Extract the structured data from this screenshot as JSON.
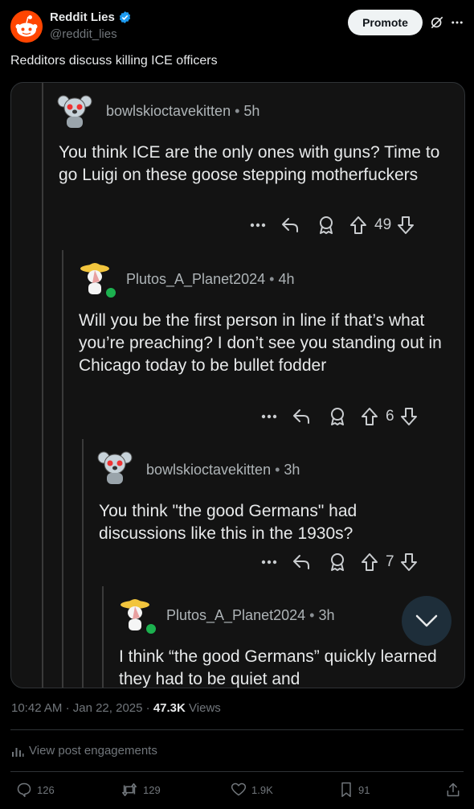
{
  "account": {
    "display_name": "Reddit Lies",
    "handle": "@reddit_lies",
    "verified": true,
    "avatar_icon": "reddit-snoo-icon"
  },
  "header": {
    "promote_label": "Promote"
  },
  "tweet": {
    "text": "Redditors discuss killing ICE officers"
  },
  "comments": [
    {
      "user": "bowlskioctavekitten",
      "age": "5h",
      "body": "You think ICE are the only ones with guns? Time to go Luigi on these goose stepping motherfuckers",
      "votes": "49"
    },
    {
      "user": "Plutos_A_Planet2024",
      "age": "4h",
      "body": "Will you be the first person in line if that’s what you’re preaching? I don’t see you standing out in Chicago today to be bullet fodder",
      "votes": "6",
      "online": true
    },
    {
      "user": "bowlskioctavekitten",
      "age": "3h",
      "body": "You think \"the good Germans\" had discussions like this in the 1930s?",
      "votes": "7"
    },
    {
      "user": "Plutos_A_Planet2024",
      "age": "3h",
      "body": "I think “the good Germans” quickly learned they had to be quiet and",
      "online": true
    }
  ],
  "meta": {
    "time": "10:42 AM",
    "date": "Jan 22, 2025",
    "views_count": "47.3K",
    "views_label": "Views"
  },
  "engagements_label": "View post engagements",
  "stats": {
    "replies": "126",
    "reposts": "129",
    "likes": "1.9K",
    "bookmarks": "91"
  },
  "colors": {
    "background": "#000000",
    "reddit_orange": "#ff4500",
    "verified_blue": "#1d9bf0",
    "online_green": "#1cb14f"
  }
}
